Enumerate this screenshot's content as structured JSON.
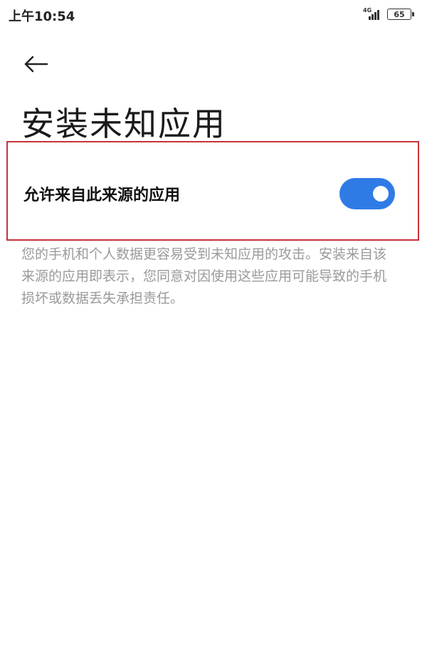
{
  "status_bar": {
    "time": "上午10:54",
    "network": "4G",
    "battery": "65"
  },
  "icons": {
    "back": "back-arrow-icon",
    "signal": "signal-icon",
    "battery": "battery-icon"
  },
  "colors": {
    "toggle_on": "#2f7be6",
    "highlight_border": "#c8323a",
    "warning_text": "#9a9a9a"
  },
  "page": {
    "title": "安装未知应用"
  },
  "setting": {
    "label": "允许来自此来源的应用",
    "toggle_state": "on"
  },
  "warning": {
    "text": "您的手机和个人数据更容易受到未知应用的攻击。安装来自该来源的应用即表示，您同意对因使用这些应用可能导致的手机损坏或数据丢失承担责任。"
  }
}
